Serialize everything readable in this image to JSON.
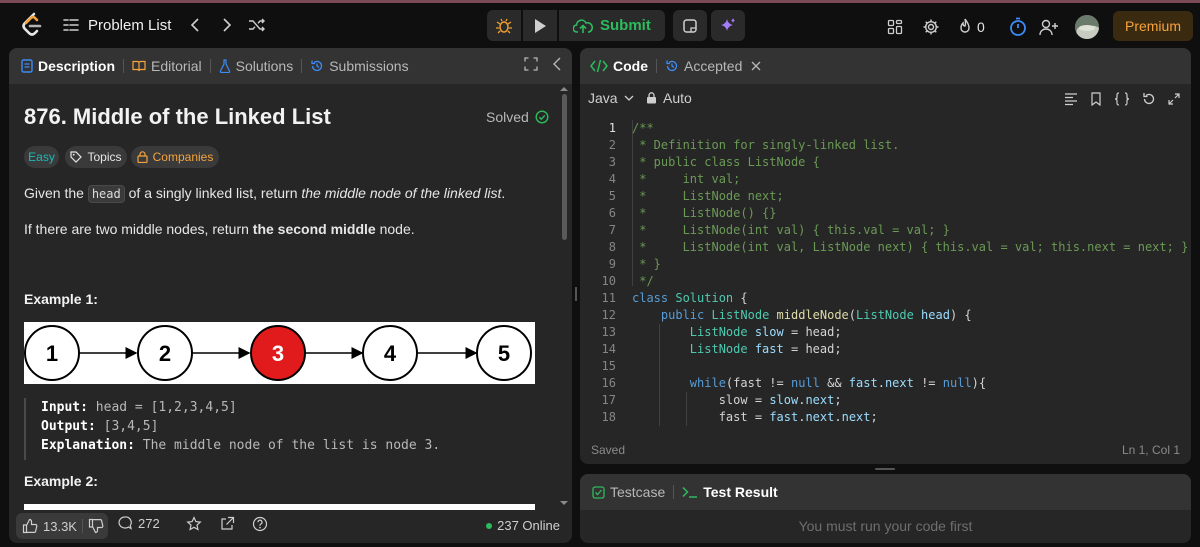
{
  "topbar": {
    "problem_list_label": "Problem List",
    "submit_label": "Submit",
    "streak_count": "0",
    "premium_label": "Premium"
  },
  "left_tabs": {
    "description": "Description",
    "editorial": "Editorial",
    "solutions": "Solutions",
    "submissions": "Submissions"
  },
  "problem": {
    "title": "876. Middle of the Linked List",
    "status": "Solved",
    "difficulty": "Easy",
    "topics_label": "Topics",
    "companies_label": "Companies",
    "p1_a": "Given the ",
    "p1_code": "head",
    "p1_b": " of a singly linked list, return ",
    "p1_em": "the middle node of the linked list",
    "p1_c": ".",
    "p2_a": "If there are two middle nodes, return ",
    "p2_strong": "the second middle",
    "p2_b": " node.",
    "example1_title": "Example 1:",
    "example2_title": "Example 2:",
    "diagram_nodes": [
      "1",
      "2",
      "3",
      "4",
      "5"
    ],
    "example1": {
      "input_label": "Input:",
      "input_value": " head = [1,2,3,4,5]",
      "output_label": "Output:",
      "output_value": " [3,4,5]",
      "explanation_label": "Explanation:",
      "explanation_value": " The middle node of the list is node 3."
    }
  },
  "bottom": {
    "likes": "13.3K",
    "comments": "272",
    "online": "237 Online"
  },
  "code_tabs": {
    "code": "Code",
    "accepted": "Accepted"
  },
  "code_toolbar": {
    "language": "Java",
    "mode": "Auto"
  },
  "code_footer": {
    "saved": "Saved",
    "position": "Ln 1, Col 1"
  },
  "test": {
    "testcase_label": "Testcase",
    "result_label": "Test Result",
    "message": "You must run your code first"
  },
  "colors": {
    "accent_green": "#2cbb5d",
    "premium": "#f7a33c",
    "easy": "#1cbaba",
    "companies": "#f7a33c",
    "node_highlight": "#e11b1b"
  },
  "code_lines": [
    "1",
    "2",
    "3",
    "4",
    "5",
    "6",
    "7",
    "8",
    "9",
    "10",
    "11",
    "12",
    "13",
    "14",
    "15",
    "16",
    "17",
    "18"
  ]
}
